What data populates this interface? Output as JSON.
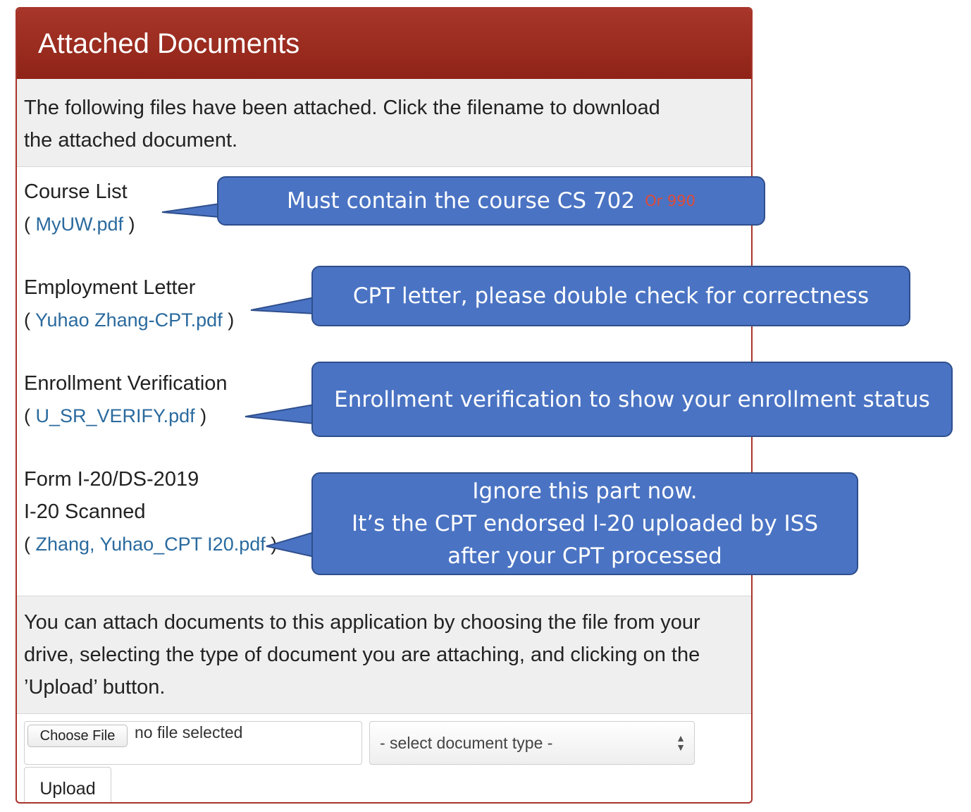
{
  "header": {
    "title": "Attached Documents"
  },
  "intro": {
    "text": "The following files have been attached. Click the filename to download the attached document."
  },
  "documents": [
    {
      "label": "Course List",
      "file": "MyUW.pdf"
    },
    {
      "label": "Employment Letter",
      "file": "Yuhao Zhang-CPT.pdf"
    },
    {
      "label": "Enrollment Verification",
      "file": "U_SR_VERIFY.pdf"
    },
    {
      "label": "Form I-20/DS-2019",
      "sublabel": "I-20 Scanned",
      "file": "Zhang, Yuhao_CPT I20.pdf"
    }
  ],
  "footer": {
    "text": "You can attach documents to this application by choosing the file from your drive, selecting the type of document you are attaching, and clicking on the ’Upload’ button."
  },
  "controls": {
    "choose_file": "Choose File",
    "no_file": "no file selected",
    "select_placeholder": "- select document type -",
    "upload": "Upload"
  },
  "callouts": {
    "course": "Must contain the course CS 702",
    "course_note": "Or 990",
    "employment": "CPT letter, please double check for correctness",
    "enrollment": "Enrollment verification to show your enrollment status",
    "i20_line1": "Ignore this part now.",
    "i20_line2": "It’s the CPT endorsed I-20 uploaded by ISS",
    "i20_line3": "after your CPT processed"
  },
  "colors": {
    "header": "#9b2c20",
    "callout": "#4a73c3",
    "link": "#2a6a9e",
    "note": "#e04b3a"
  }
}
